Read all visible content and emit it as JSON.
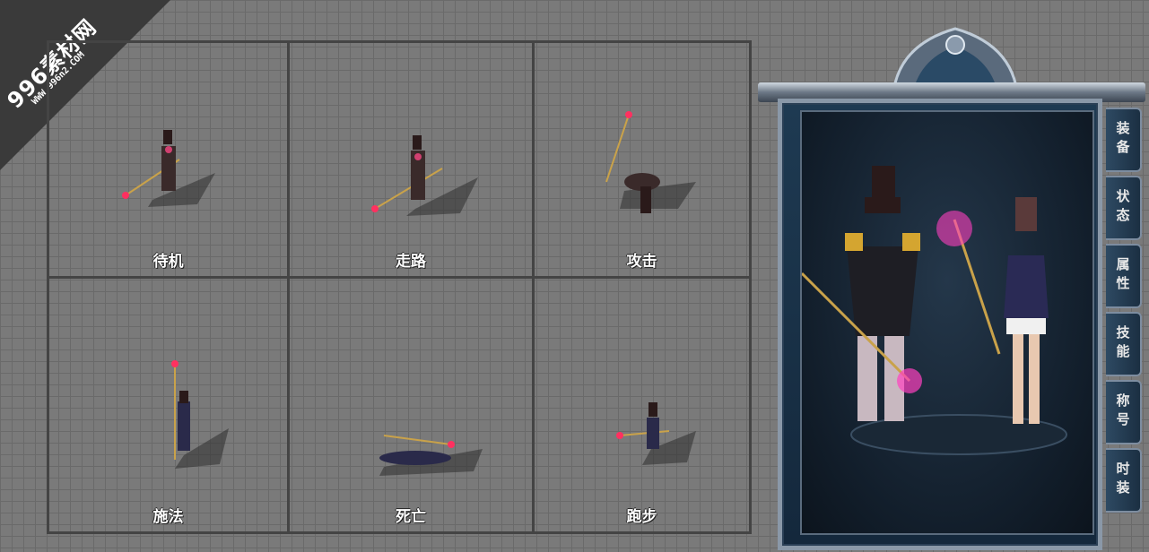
{
  "watermark": {
    "title": "996素材网",
    "url": "WWW.996n2.COM"
  },
  "animations": [
    {
      "label": "待机"
    },
    {
      "label": "走路"
    },
    {
      "label": "攻击"
    },
    {
      "label": "施法"
    },
    {
      "label": "死亡"
    },
    {
      "label": "跑步"
    }
  ],
  "panel_tabs": [
    "装备",
    "状态",
    "属性",
    "技能",
    "称号",
    "时装"
  ],
  "colors": {
    "background": "#7a7a7a",
    "grid_line": "#444444",
    "frame": "#1e3a52",
    "tab_text": "#e8e8e8"
  }
}
